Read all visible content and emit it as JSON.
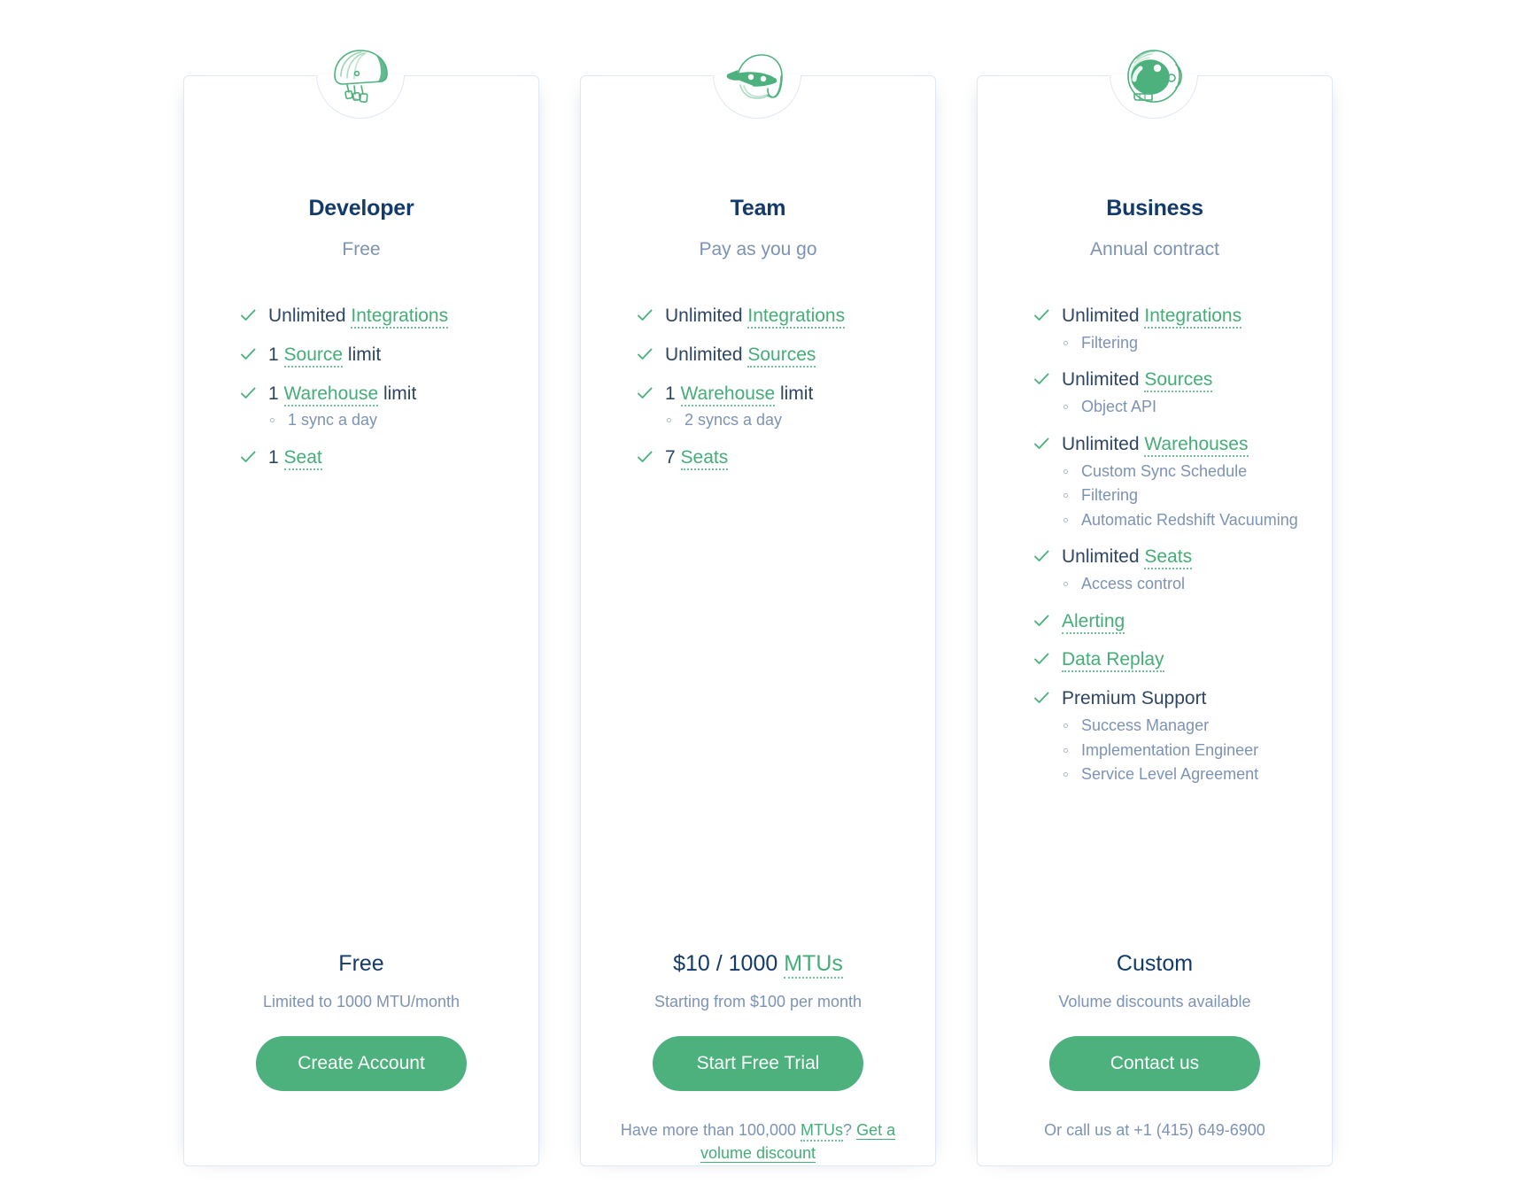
{
  "colors": {
    "green": "#4cb17d",
    "green_text": "#45ad78",
    "navy": "#123a6b",
    "body_text": "#2f4663",
    "muted": "#7d93b4",
    "border": "#dfe7f3"
  },
  "plans": [
    {
      "icon_name": "bike-helmet-icon",
      "name": "Developer",
      "subtitle": "Free",
      "features": [
        {
          "parts": [
            {
              "text": "Unlimited ",
              "style": "plain"
            },
            {
              "text": "Integrations",
              "style": "term"
            }
          ],
          "subs": []
        },
        {
          "parts": [
            {
              "text": "1 ",
              "style": "plain"
            },
            {
              "text": "Source",
              "style": "term"
            },
            {
              "text": " limit",
              "style": "plain"
            }
          ],
          "subs": []
        },
        {
          "parts": [
            {
              "text": "1 ",
              "style": "plain"
            },
            {
              "text": "Warehouse",
              "style": "term"
            },
            {
              "text": " limit",
              "style": "plain"
            }
          ],
          "subs": [
            "1 sync a day"
          ]
        },
        {
          "parts": [
            {
              "text": "1 ",
              "style": "plain"
            },
            {
              "text": "Seat",
              "style": "term"
            }
          ],
          "subs": []
        }
      ],
      "price_parts": [
        {
          "text": "Free",
          "style": "plain"
        }
      ],
      "price_note": "Limited to 1000 MTU/month",
      "cta_label": "Create Account",
      "foot_note_parts": []
    },
    {
      "icon_name": "motorcycle-helmet-icon",
      "name": "Team",
      "subtitle": "Pay as you go",
      "features": [
        {
          "parts": [
            {
              "text": "Unlimited ",
              "style": "plain"
            },
            {
              "text": "Integrations",
              "style": "term"
            }
          ],
          "subs": []
        },
        {
          "parts": [
            {
              "text": "Unlimited ",
              "style": "plain"
            },
            {
              "text": "Sources",
              "style": "term"
            }
          ],
          "subs": []
        },
        {
          "parts": [
            {
              "text": "1 ",
              "style": "plain"
            },
            {
              "text": "Warehouse",
              "style": "term"
            },
            {
              "text": " limit",
              "style": "plain"
            }
          ],
          "subs": [
            "2 syncs a day"
          ]
        },
        {
          "parts": [
            {
              "text": "7 ",
              "style": "plain"
            },
            {
              "text": "Seats",
              "style": "term"
            }
          ],
          "subs": []
        }
      ],
      "price_parts": [
        {
          "text": "$10 / 1000 ",
          "style": "plain"
        },
        {
          "text": "MTUs",
          "style": "term"
        }
      ],
      "price_note": "Starting from $100 per month",
      "cta_label": "Start Free Trial",
      "foot_note_parts": [
        {
          "text": "Have more than 100,000 ",
          "style": "plain"
        },
        {
          "text": "MTUs",
          "style": "term"
        },
        {
          "text": "? ",
          "style": "plain"
        },
        {
          "text": "Get a volume discount",
          "style": "link"
        }
      ]
    },
    {
      "icon_name": "astronaut-helmet-icon",
      "name": "Business",
      "subtitle": "Annual contract",
      "features": [
        {
          "parts": [
            {
              "text": "Unlimited ",
              "style": "plain"
            },
            {
              "text": "Integrations",
              "style": "term"
            }
          ],
          "subs": [
            "Filtering"
          ]
        },
        {
          "parts": [
            {
              "text": "Unlimited ",
              "style": "plain"
            },
            {
              "text": "Sources",
              "style": "term"
            }
          ],
          "subs": [
            "Object API"
          ]
        },
        {
          "parts": [
            {
              "text": "Unlimited ",
              "style": "plain"
            },
            {
              "text": "Warehouses",
              "style": "term"
            }
          ],
          "subs": [
            "Custom Sync Schedule",
            "Filtering",
            "Automatic Redshift Vacuuming"
          ]
        },
        {
          "parts": [
            {
              "text": "Unlimited ",
              "style": "plain"
            },
            {
              "text": "Seats",
              "style": "term"
            }
          ],
          "subs": [
            "Access control"
          ]
        },
        {
          "parts": [
            {
              "text": "Alerting",
              "style": "term"
            }
          ],
          "subs": []
        },
        {
          "parts": [
            {
              "text": "Data Replay",
              "style": "term"
            }
          ],
          "subs": []
        },
        {
          "parts": [
            {
              "text": "Premium Support",
              "style": "plain"
            }
          ],
          "subs": [
            "Success Manager",
            "Implementation Engineer",
            "Service Level Agreement"
          ]
        }
      ],
      "price_parts": [
        {
          "text": "Custom",
          "style": "plain"
        }
      ],
      "price_note": "Volume discounts available",
      "cta_label": "Contact us",
      "foot_note_parts": [
        {
          "text": "Or call us at +1 (415) 649-6900",
          "style": "plain"
        }
      ]
    }
  ]
}
